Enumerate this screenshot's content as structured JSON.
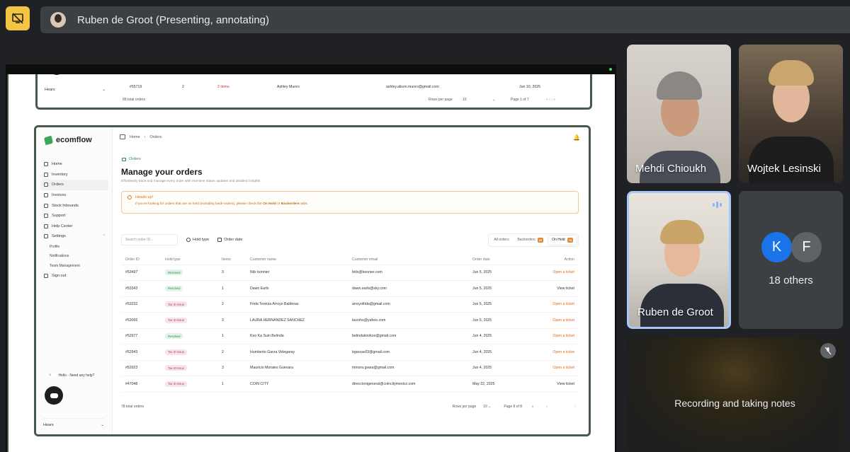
{
  "meeting": {
    "presenter_title": "Ruben de Groot (Presenting, annotating)"
  },
  "participants": [
    {
      "name": "Mehdi Chioukh"
    },
    {
      "name": "Wojtek Lesinski"
    },
    {
      "name": "Ruben de Groot"
    }
  ],
  "others": {
    "avatars": [
      "K",
      "F"
    ],
    "label": "18 others"
  },
  "recording": {
    "label": "Recording and taking notes"
  },
  "app": {
    "brand": "ecomflow",
    "nav": [
      "Home",
      "Inventory",
      "Orders",
      "Invoices",
      "Stock Inbounds",
      "Support",
      "Help Center",
      "Settings"
    ],
    "settings_sub": [
      "Profile",
      "Notifications",
      "Team Management"
    ],
    "sign_out": "Sign out",
    "chat_prompt": "Hello - Need any help?",
    "user": "Hears"
  },
  "breadcrumb": {
    "home": "Home",
    "current": "Orders"
  },
  "page": {
    "tag": "Orders",
    "title": "Manage your orders",
    "subtitle": "Effortlessly track and manage every order with real-time status updates and detailed insights"
  },
  "alert": {
    "title": "Heads up!",
    "body_prefix": "If you're looking for orders that are on hold (including back-orders), please check the",
    "link1": "On Hold",
    "middle": "or",
    "link2": "Backorders",
    "suffix": "tabs."
  },
  "filters": {
    "search_placeholder": "Search order ID...",
    "hold_type": "Hold type",
    "order_date": "Order date",
    "tabs": [
      {
        "label": "All orders",
        "badge": ""
      },
      {
        "label": "Backorders",
        "badge": "65"
      },
      {
        "label": "On Hold",
        "badge": "78"
      }
    ]
  },
  "table": {
    "headers": [
      "Order ID",
      "Hold type",
      "Items",
      "Customer name",
      "Customer email",
      "Order date",
      "Action"
    ],
    "rows": [
      {
        "id": "#53497",
        "hold": "Resolved",
        "hold_color": "green",
        "items": "3",
        "name": "Nilx bonnier",
        "email": "felix@bonnier.com",
        "date": "Jun 5, 2025",
        "action": "Open a ticket",
        "action_color": "orange"
      },
      {
        "id": "#53343",
        "hold": "Resolved",
        "hold_color": "green",
        "items": "1",
        "name": "Dawn Earls",
        "email": "dawn.earls@sky.com",
        "date": "Jun 5, 2025",
        "action": "View ticket",
        "action_color": "dark"
      },
      {
        "id": "#53232",
        "hold": "Tax ID Issue",
        "hold_color": "pink",
        "items": "2",
        "name": "Frida Teretza Arroyo Balderas",
        "email": "arroyofrida@gmail.com",
        "date": "Jun 5, 2025",
        "action": "Open a ticket",
        "action_color": "orange"
      },
      {
        "id": "#53065",
        "hold": "Tax ID Issue",
        "hold_color": "pink",
        "items": "3",
        "name": "LAURA HERNANDEZ SANCHEZ",
        "email": "laurshs@yahoo.com",
        "date": "Jun 5, 2025",
        "action": "Open a ticket",
        "action_color": "orange"
      },
      {
        "id": "#52977",
        "hold": "Resolved",
        "hold_color": "green",
        "items": "1",
        "name": "Koo Ka Suin Belinda",
        "email": "belindakookoo@gmail.com",
        "date": "Jun 4, 2025",
        "action": "Open a ticket",
        "action_color": "orange"
      },
      {
        "id": "#52943",
        "hold": "Tax ID Issue",
        "hold_color": "pink",
        "items": "2",
        "name": "Humberto Garza Videgaray",
        "email": "bgarzav03@gmail.com",
        "date": "Jun 4, 2025",
        "action": "Open a ticket",
        "action_color": "orange"
      },
      {
        "id": "#52923",
        "hold": "Tax ID Issue",
        "hold_color": "pink",
        "items": "3",
        "name": "Mauricio Morales Guevara",
        "email": "mmora.gvara@gmail.com",
        "date": "Jun 4, 2025",
        "action": "Open a ticket",
        "action_color": "orange"
      },
      {
        "id": "#47048",
        "hold": "Tax ID Issue",
        "hold_color": "pink",
        "items": "1",
        "name": "COIN CITY",
        "email": "direccionigeneral@coincitymexico.com",
        "date": "May 22, 2025",
        "action": "View ticket",
        "action_color": "dark"
      }
    ]
  },
  "footer": {
    "total": "78 total orders",
    "rows_per_page_label": "Rows per page",
    "rows_per_page": "10",
    "page_info": "Page 8 of 8"
  },
  "back_window": {
    "row": {
      "id": "#55719",
      "items": "2",
      "items_link": "2 items",
      "name": "Ashley Munro",
      "email": "ashley.alison.munro@gmail.com",
      "date": "Jun 10, 2025"
    },
    "total": "68 total orders",
    "rows_per_page_label": "Rows per page",
    "rows_per_page": "10",
    "page_info": "Page 1 of 7",
    "user": "Hears"
  }
}
